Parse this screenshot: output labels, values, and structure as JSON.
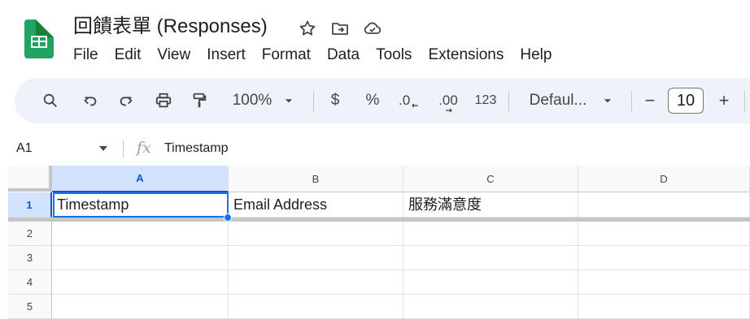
{
  "app": {
    "title": "回饋表單 (Responses)",
    "icons": [
      "star-icon",
      "move-to-folder-icon",
      "cloud-status-icon"
    ]
  },
  "menu": [
    "File",
    "Edit",
    "View",
    "Insert",
    "Format",
    "Data",
    "Tools",
    "Extensions",
    "Help"
  ],
  "toolbar": {
    "zoom": "100%",
    "currency": "$",
    "percent": "%",
    "decrease_decimal": ".0",
    "increase_decimal": ".00",
    "number_format": "123",
    "font": "Defaul...",
    "font_size": "10",
    "minus": "−",
    "plus": "+"
  },
  "formula_bar": {
    "cell_ref": "A1",
    "fx": "fx",
    "content": "Timestamp"
  },
  "columns": [
    "A",
    "B",
    "C",
    "D"
  ],
  "rows": [
    "1",
    "2",
    "3",
    "4",
    "5"
  ],
  "cells": {
    "A1": "Timestamp",
    "B1": "Email Address",
    "C1": "服務滿意度",
    "D1": ""
  },
  "colors": {
    "accent": "#1a73e8",
    "selection_header": "#d3e3fd",
    "toolbar_bg": "#eef2f9",
    "sheets_green": "#1fa463"
  }
}
